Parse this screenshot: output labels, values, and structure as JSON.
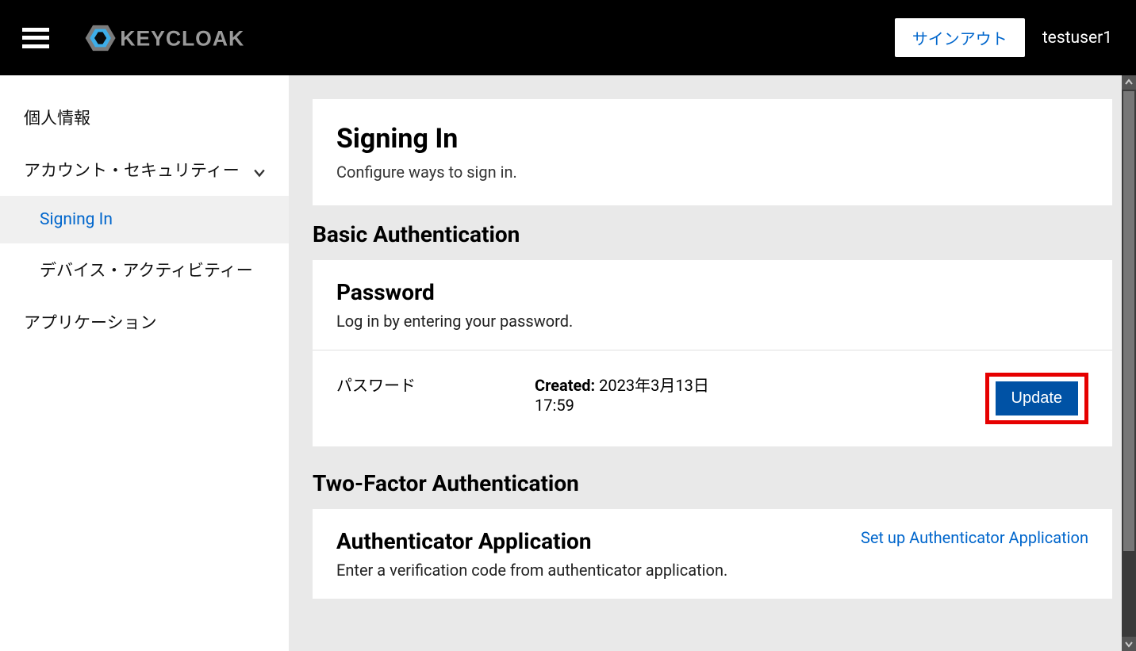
{
  "header": {
    "brand": "KEYCLOAK",
    "signout": "サインアウト",
    "username": "testuser1"
  },
  "sidebar": {
    "items": [
      {
        "label": "個人情報"
      },
      {
        "label": "アカウント・セキュリティー",
        "expandable": true
      },
      {
        "label": "Signing In",
        "active": true
      },
      {
        "label": "デバイス・アクティビティー"
      },
      {
        "label": "アプリケーション"
      }
    ]
  },
  "page": {
    "title": "Signing In",
    "subtitle": "Configure ways to sign in."
  },
  "basic": {
    "section": "Basic Authentication",
    "title": "Password",
    "desc": "Log in by entering your password.",
    "row_label": "パスワード",
    "created_label": "Created:",
    "created_value": "2023年3月13日 17:59",
    "update": "Update"
  },
  "twofa": {
    "section": "Two-Factor Authentication",
    "title": "Authenticator Application",
    "desc": "Enter a verification code from authenticator application.",
    "setup": "Set up Authenticator Application"
  }
}
